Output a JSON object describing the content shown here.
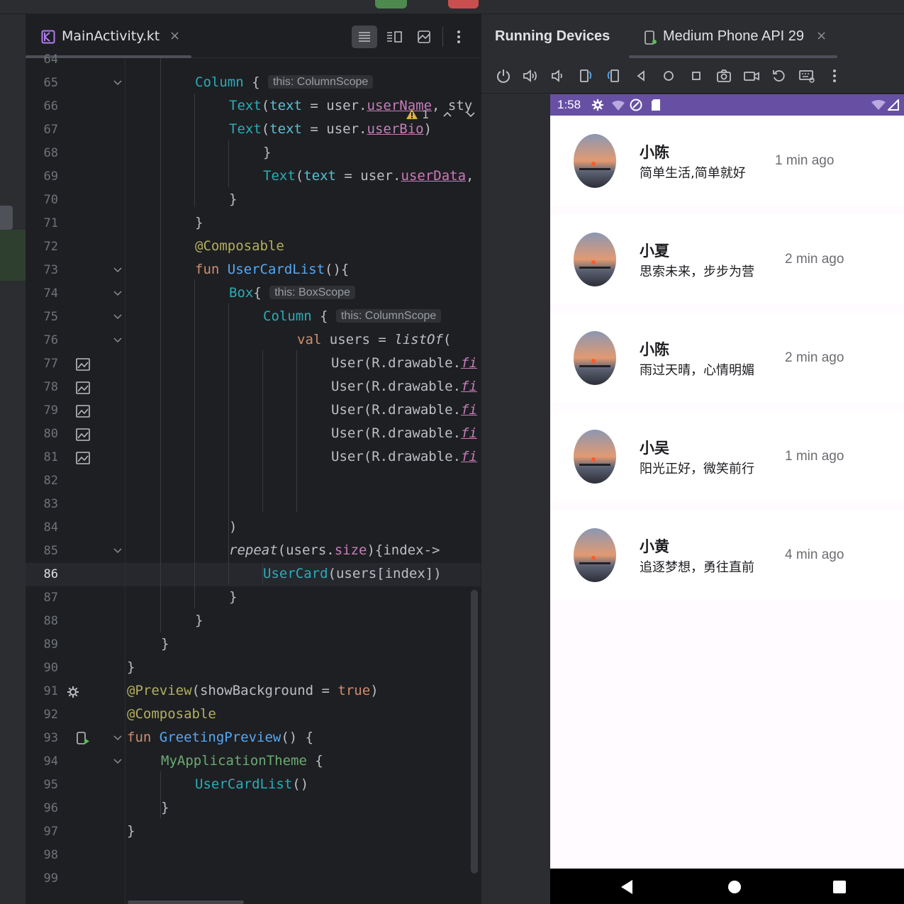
{
  "editor": {
    "file_tab": "MainActivity.kt",
    "close_glyph": "×",
    "warning_count": "1",
    "lines": [
      {
        "n": "64",
        "indent": 0,
        "parts": []
      },
      {
        "n": "65",
        "indent": 0,
        "parts": []
      },
      {
        "n": "66",
        "parts": []
      },
      {
        "n": "67",
        "parts": []
      },
      {
        "n": "68",
        "parts": []
      },
      {
        "n": "69",
        "parts": []
      },
      {
        "n": "70",
        "parts": []
      },
      {
        "n": "71",
        "parts": []
      },
      {
        "n": "72",
        "parts": []
      },
      {
        "n": "73",
        "parts": []
      },
      {
        "n": "74",
        "parts": []
      },
      {
        "n": "75",
        "parts": []
      },
      {
        "n": "76",
        "parts": []
      },
      {
        "n": "77",
        "parts": []
      },
      {
        "n": "78",
        "parts": []
      },
      {
        "n": "79",
        "parts": []
      },
      {
        "n": "80",
        "parts": []
      },
      {
        "n": "81",
        "parts": []
      },
      {
        "n": "82",
        "parts": []
      },
      {
        "n": "83",
        "parts": []
      },
      {
        "n": "84",
        "parts": []
      },
      {
        "n": "85",
        "parts": []
      },
      {
        "n": "86",
        "parts": []
      },
      {
        "n": "87",
        "parts": []
      },
      {
        "n": "88",
        "parts": []
      },
      {
        "n": "89",
        "parts": []
      },
      {
        "n": "90",
        "parts": []
      },
      {
        "n": "91",
        "parts": []
      },
      {
        "n": "92",
        "parts": []
      },
      {
        "n": "93",
        "parts": []
      },
      {
        "n": "94",
        "parts": []
      },
      {
        "n": "95",
        "parts": []
      },
      {
        "n": "96",
        "parts": []
      },
      {
        "n": "97",
        "parts": []
      },
      {
        "n": "98",
        "parts": []
      },
      {
        "n": "99",
        "parts": []
      }
    ],
    "code": {
      "l65": [
        "Column",
        " {",
        "this: ColumnScope"
      ],
      "l66": [
        "Text",
        "(",
        "text",
        " = user.",
        "userName",
        ", sty"
      ],
      "l67": [
        "Text",
        "(",
        "text",
        " = user.",
        "userBio",
        ")"
      ],
      "l68": [
        "}"
      ],
      "l69": [
        "Text",
        "(",
        "text",
        " = user.",
        "userData",
        ","
      ],
      "l70": [
        "}"
      ],
      "l71": [
        "}"
      ],
      "l72": [
        "@Composable"
      ],
      "l73": [
        "fun ",
        "UserCardList",
        "(){"
      ],
      "l74": [
        "Box",
        "{",
        "this: BoxScope"
      ],
      "l75": [
        "Column",
        " {",
        "this: ColumnScope"
      ],
      "l76": [
        "val ",
        "users = ",
        "listOf",
        "("
      ],
      "l77": [
        "User(R.drawable.",
        "fi"
      ],
      "l78": [
        "User(R.drawable.",
        "fi"
      ],
      "l79": [
        "User(R.drawable.",
        "fi"
      ],
      "l80": [
        "User(R.drawable.",
        "fi"
      ],
      "l81": [
        "User(R.drawable.",
        "fi"
      ],
      "l84": [
        ")"
      ],
      "l85": [
        "repeat",
        "(users.",
        "size",
        "){index->"
      ],
      "l86": [
        "UserCard",
        "(users[index])"
      ],
      "l87": [
        "}"
      ],
      "l88": [
        "}"
      ],
      "l89": [
        "}"
      ],
      "l90": [
        "}"
      ],
      "l91": [
        "@Preview",
        "(showBackground = ",
        "true",
        ")"
      ],
      "l92": [
        "@Composable"
      ],
      "l93": [
        "fun ",
        "GreetingPreview",
        "() {"
      ],
      "l94": [
        "MyApplicationTheme",
        " {"
      ],
      "l95": [
        "UserCardList",
        "()"
      ],
      "l96": [
        "}"
      ],
      "l97": [
        "}"
      ]
    }
  },
  "devices": {
    "title": "Running Devices",
    "device_tab": "Medium Phone API 29",
    "close_glyph": "×"
  },
  "phone": {
    "status_time": "1:58",
    "users": [
      {
        "name": "小陈",
        "bio": "简单生活,简单就好",
        "time": "1 min ago"
      },
      {
        "name": "小夏",
        "bio": "思索未来，步步为营",
        "time": "2 min ago"
      },
      {
        "name": "小陈",
        "bio": "雨过天晴，心情明媚",
        "time": "2 min ago"
      },
      {
        "name": "小吴",
        "bio": "阳光正好，微笑前行",
        "time": "1 min ago"
      },
      {
        "name": "小黄",
        "bio": "追逐梦想，勇往直前",
        "time": "4 min ago"
      }
    ]
  },
  "colors": {
    "status_bar": "#6750a4",
    "keyword": "#cf8e6d",
    "function": "#56a8f5",
    "call": "#2aacb8"
  }
}
